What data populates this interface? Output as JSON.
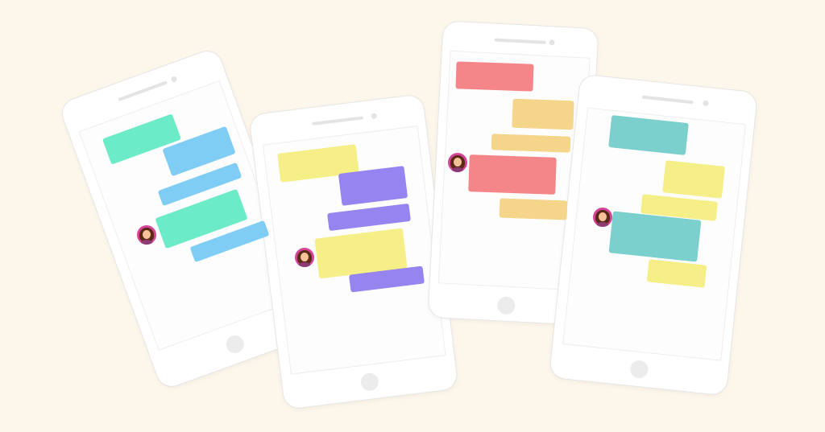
{
  "colors": {
    "background": "#fdf6ea",
    "green": "#6cebc8",
    "blue": "#7fcdf5",
    "yellow": "#f6ee86",
    "purple": "#9684f0",
    "red": "#f4868a",
    "orange": "#f5d58a",
    "teal": "#7bcfcc"
  },
  "icons": {
    "avatar": "woman-avatar-icon",
    "home": "home-button-icon",
    "camera": "camera-icon",
    "speaker": "speaker-icon"
  },
  "phones": [
    {
      "name": "phone-1",
      "bubble_colors": [
        "green",
        "blue",
        "blue",
        "green",
        "blue"
      ],
      "has_avatar": true
    },
    {
      "name": "phone-2",
      "bubble_colors": [
        "yellow",
        "purple",
        "purple",
        "yellow",
        "purple"
      ],
      "has_avatar": true
    },
    {
      "name": "phone-3",
      "bubble_colors": [
        "red",
        "orange",
        "orange",
        "red",
        "orange"
      ],
      "has_avatar": true
    },
    {
      "name": "phone-4",
      "bubble_colors": [
        "teal",
        "yellow",
        "yellow",
        "teal",
        "yellow"
      ],
      "has_avatar": true
    }
  ]
}
